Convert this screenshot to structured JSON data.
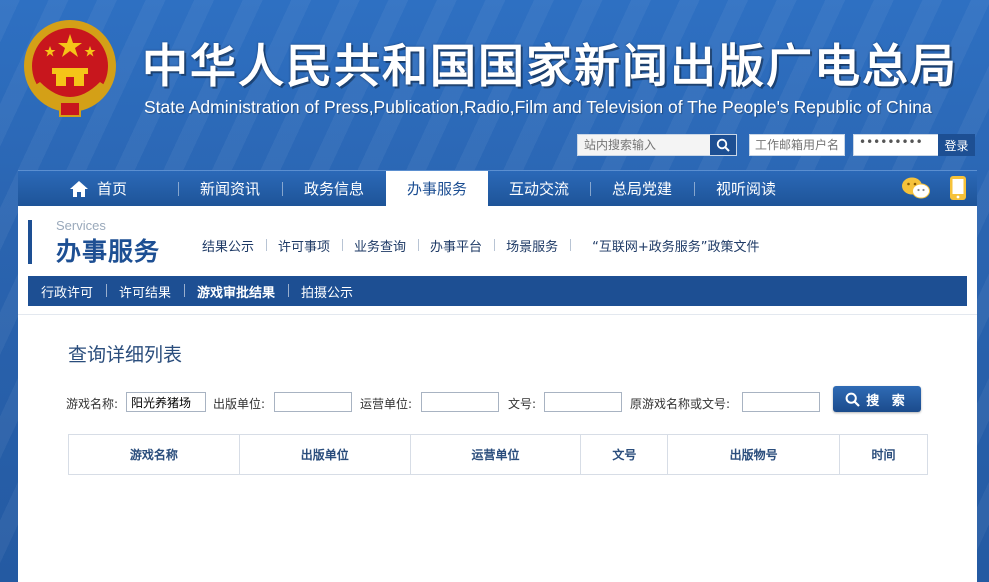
{
  "header": {
    "title": "中华人民共和国国家新闻出版广电总局",
    "subtitle": "State Administration of Press,Publication,Radio,Film and Television of The People's Republic of China",
    "emblem_icon": "national-emblem-icon",
    "search_placeholder": "站内搜索输入",
    "email_user_placeholder": "工作邮箱用户名",
    "password_mask": "•••••••••",
    "login_label": "登录"
  },
  "nav": {
    "items": [
      {
        "label": "首页",
        "icon": "home-icon"
      },
      {
        "label": "新闻资讯"
      },
      {
        "label": "政务信息"
      },
      {
        "label": "办事服务",
        "active": true
      },
      {
        "label": "互动交流"
      },
      {
        "label": "总局党建"
      },
      {
        "label": "视听阅读"
      }
    ],
    "right_icons": [
      "wechat-icon",
      "mobile-icon"
    ]
  },
  "section": {
    "en_label": "Services",
    "cn_label": "办事服务",
    "subnav": [
      "结果公示",
      "许可事项",
      "业务查询",
      "办事平台",
      "场景服务",
      "“互联网+政务服务”政策文件"
    ],
    "tabs": [
      "行政许可",
      "许可结果",
      "游戏审批结果",
      "拍摄公示"
    ],
    "active_tab": "游戏审批结果"
  },
  "page": {
    "title": "查询详细列表"
  },
  "form": {
    "game_name_label": "游戏名称:",
    "game_name_value": "阳光养猪场",
    "publisher_label": "出版单位:",
    "publisher_value": "",
    "operator_label": "运营单位:",
    "operator_value": "",
    "doc_no_label": "文号:",
    "doc_no_value": "",
    "orig_label": "原游戏名称或文号:",
    "orig_value": "",
    "search_label": "搜 索"
  },
  "table": {
    "columns": [
      "游戏名称",
      "出版单位",
      "运营单位",
      "文号",
      "出版物号",
      "时间"
    ]
  },
  "colors": {
    "brand_blue": "#1d4f93",
    "banner_blue": "#2a64b0"
  }
}
